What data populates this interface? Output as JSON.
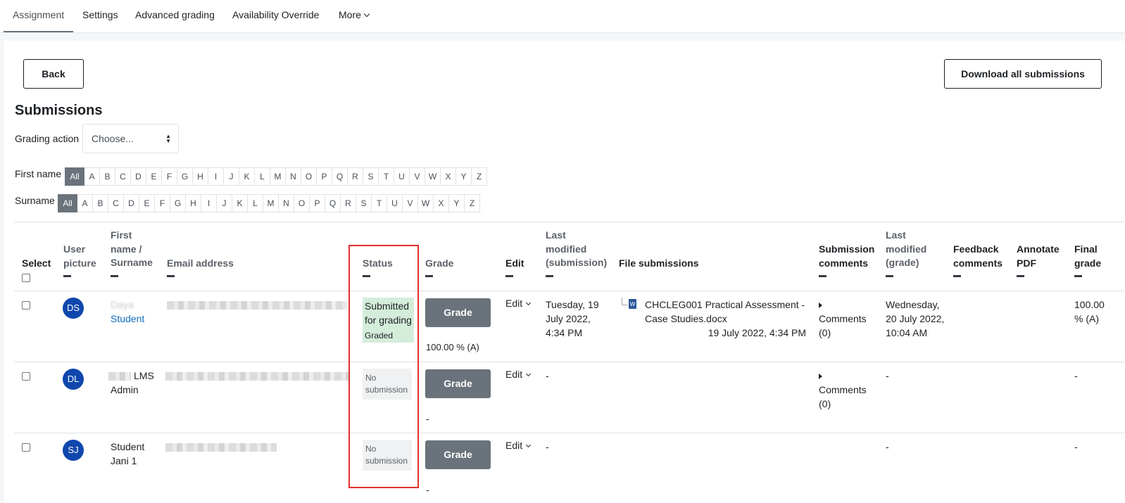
{
  "tabs": [
    "Assignment",
    "Settings",
    "Advanced grading",
    "Availability Override",
    "More"
  ],
  "actions": {
    "back": "Back",
    "download": "Download all submissions"
  },
  "heading": "Submissions",
  "grading_action": {
    "label": "Grading action",
    "selected": "Choose..."
  },
  "filters": {
    "first_name_label": "First name",
    "surname_label": "Surname",
    "all": "All",
    "letters": [
      "A",
      "B",
      "C",
      "D",
      "E",
      "F",
      "G",
      "H",
      "I",
      "J",
      "K",
      "L",
      "M",
      "N",
      "O",
      "P",
      "Q",
      "R",
      "S",
      "T",
      "U",
      "V",
      "W",
      "X",
      "Y",
      "Z"
    ]
  },
  "columns": {
    "select": "Select",
    "user_picture": "User picture",
    "name": "First name / Surname",
    "email": "Email address",
    "status": "Status",
    "grade": "Grade",
    "edit": "Edit",
    "last_modified_submission": "Last modified (submission)",
    "file_submissions": "File submissions",
    "submission_comments": "Submission comments",
    "last_modified_grade": "Last modified (grade)",
    "feedback_comments": "Feedback comments",
    "annotate_pdf": "Annotate PDF",
    "final_grade": "Final grade"
  },
  "rows": [
    {
      "initials": "DS",
      "name_line1": "Daya",
      "name_line2": "Student",
      "status": "Submitted for grading",
      "status_sub": "Graded",
      "grade_button": "Grade",
      "grade_value": "100.00 % (A)",
      "edit": "Edit",
      "last_modified_submission": "Tuesday, 19 July 2022, 4:34 PM",
      "file_name": "CHCLEG001 Practical Assessment - Case Studies.docx",
      "file_date": "19 July 2022, 4:34 PM",
      "comments": "Comments (0)",
      "last_modified_grade": "Wednesday, 20 July 2022, 10:04 AM",
      "final_grade": "100.00 % (A)"
    },
    {
      "initials": "DL",
      "name_line1": "LMS",
      "name_line2": "Admin",
      "status": "No submission",
      "grade_button": "Grade",
      "grade_value": "-",
      "edit": "Edit",
      "last_modified_submission": "-",
      "comments": "Comments (0)",
      "last_modified_grade": "-",
      "final_grade": "-"
    },
    {
      "initials": "SJ",
      "name_line1": "Student",
      "name_line2": "Jani 1",
      "status": "No submission",
      "grade_button": "Grade",
      "grade_value": "-",
      "edit": "Edit",
      "last_modified_submission": "-",
      "last_modified_grade": "-",
      "final_grade": "-"
    }
  ],
  "colors": {
    "avatar": "#0f47ad",
    "grade_button": "#6a737b",
    "status_submitted": "#d4edda",
    "highlight_box": "#e0312c"
  }
}
